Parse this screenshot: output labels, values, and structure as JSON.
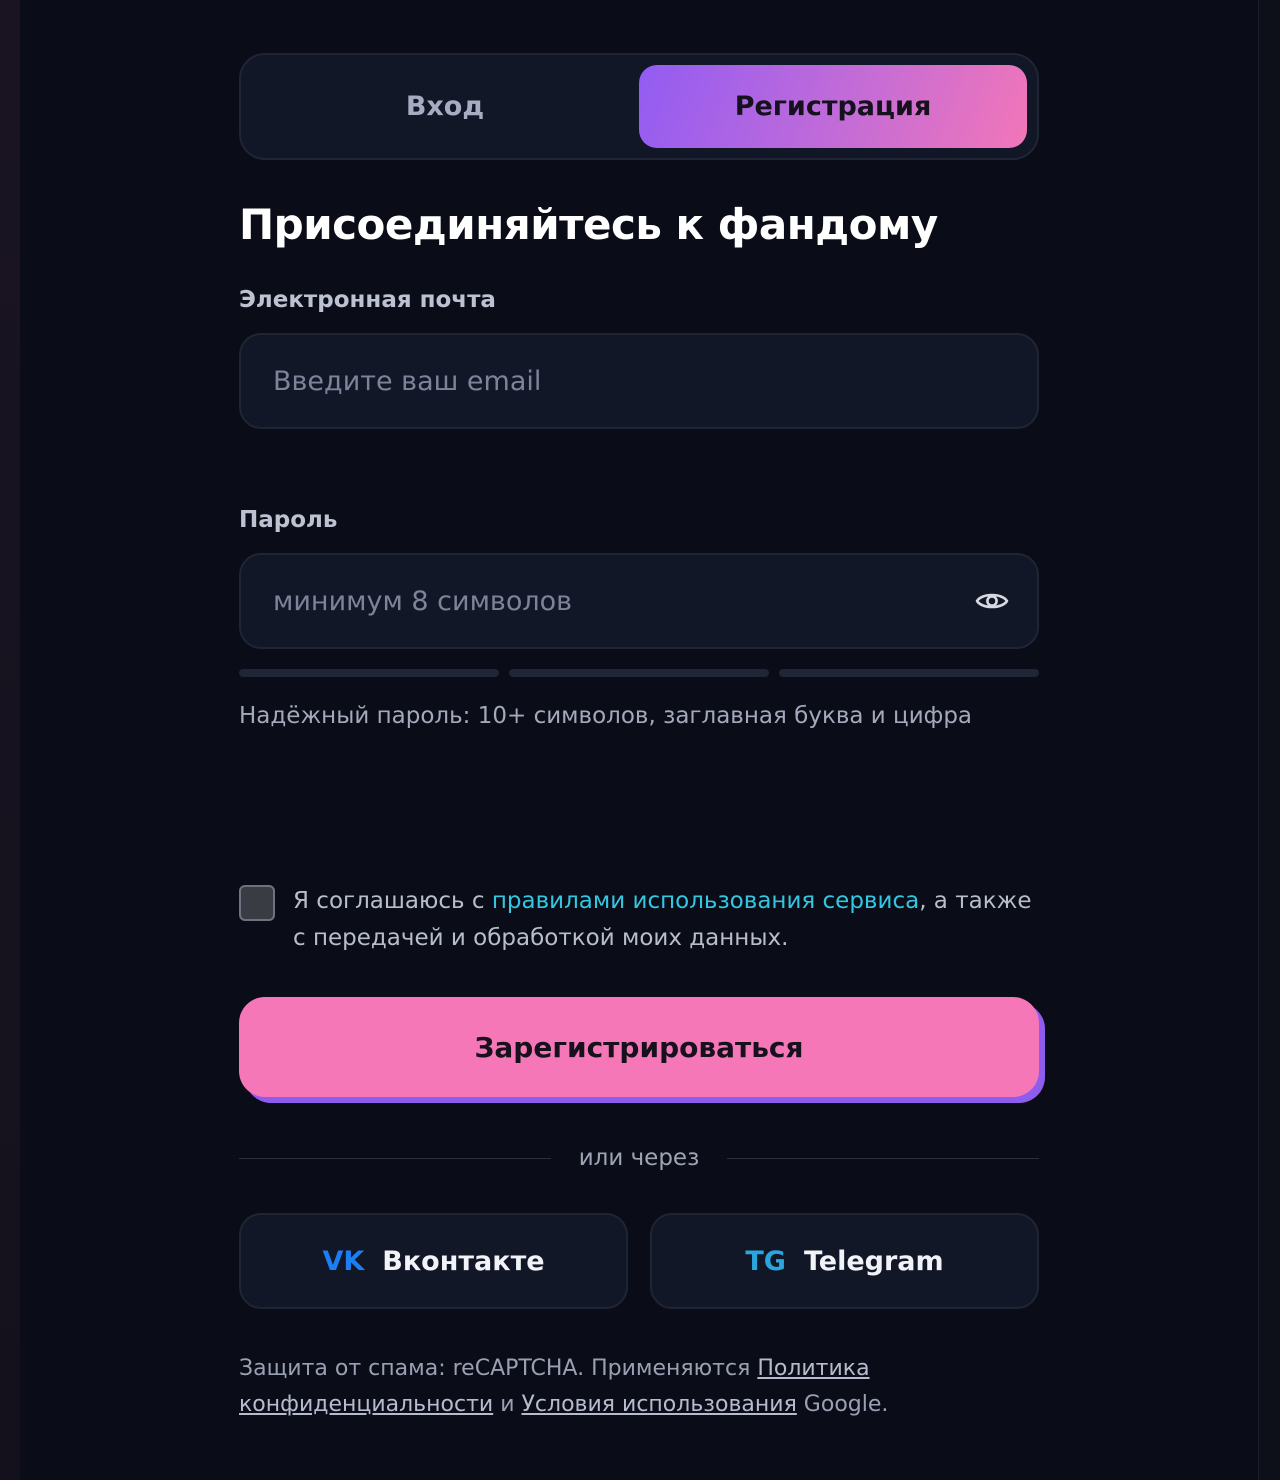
{
  "tabs": {
    "login": "Вход",
    "register": "Регистрация",
    "active": "register"
  },
  "heading": "Присоединяйтесь к фандому",
  "email": {
    "label": "Электронная почта",
    "placeholder": "Введите ваш email",
    "value": ""
  },
  "password": {
    "label": "Пароль",
    "placeholder": "минимум 8 символов",
    "value": "",
    "toggle_icon": "eye-icon",
    "strength_segments_filled": 0,
    "strength_segments_total": 3,
    "hint": "Надёжный пароль: 10+ символов, заглавная буква и цифра"
  },
  "agreement": {
    "checked": false,
    "prefix": "Я соглашаюсь с ",
    "link": "правилами использования сервиса",
    "suffix": ", а также с передачей и обработкой моих данных."
  },
  "submit_label": "Зарегистрироваться",
  "divider_text": "или через",
  "social": [
    {
      "badge": "VK",
      "name": "Вконтакте",
      "badge_color": "#1d7df2"
    },
    {
      "badge": "TG",
      "name": "Telegram",
      "badge_color": "#2aa6df"
    }
  ],
  "footer": {
    "prefix": "Защита от спама: reCAPTCHA. Применяются ",
    "privacy_link": "Политика конфиденциальности",
    "middle": " и ",
    "terms_link": "Условия использования",
    "suffix": " Google."
  },
  "colors": {
    "background": "#0a0d17",
    "card": "#111726",
    "accent_pink": "#f577b8",
    "accent_purple": "#925cf3",
    "link_cyan": "#32c6e0"
  }
}
